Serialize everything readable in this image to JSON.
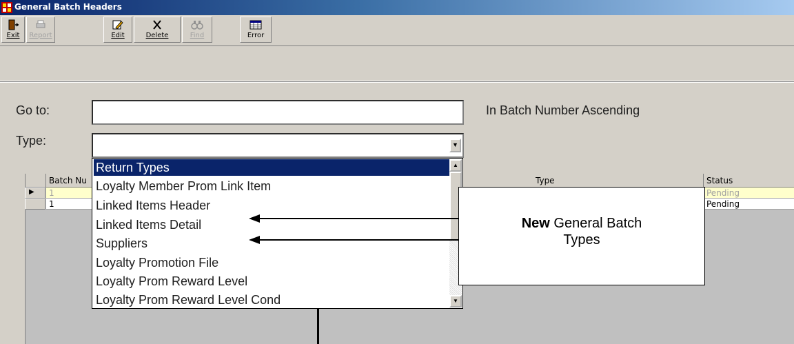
{
  "window": {
    "title": "General Batch Headers"
  },
  "toolbar": {
    "buttons": [
      {
        "label": "Exit",
        "icon": "exit-door-icon",
        "enabled": true
      },
      {
        "label": "Report",
        "icon": "printer-icon",
        "enabled": false
      },
      {
        "label": "Edit",
        "icon": "edit-pencil-icon",
        "enabled": true
      },
      {
        "label": "Delete",
        "icon": "delete-x-icon",
        "enabled": true
      },
      {
        "label": "Find",
        "icon": "binoculars-icon",
        "enabled": false
      },
      {
        "label": "Error",
        "icon": "grid-table-icon",
        "enabled": true
      }
    ]
  },
  "form": {
    "goto_label": "Go to:",
    "goto_value": "",
    "sort_text": "In Batch Number Ascending",
    "type_label": "Type:",
    "type_value": ""
  },
  "grid": {
    "columns": [
      "Batch Nu",
      "Type",
      "Status"
    ],
    "rows": [
      {
        "batch": "1",
        "status": "Pending"
      },
      {
        "batch": "1",
        "status": "Pending"
      }
    ]
  },
  "dropdown": {
    "items": [
      "Return Types",
      "Loyalty Member Prom Link Item",
      "Linked Items Header",
      "Linked Items Detail",
      "Suppliers",
      "Loyalty Promotion File",
      "Loyalty Prom Reward Level",
      "Loyalty Prom Reward Level Cond"
    ],
    "selected_index": 0
  },
  "callout": {
    "bold": "New",
    "text1": " General Batch",
    "text2": "Types"
  },
  "colors": {
    "selection": "#0a246a",
    "highlight_row": "#ffffcc"
  }
}
